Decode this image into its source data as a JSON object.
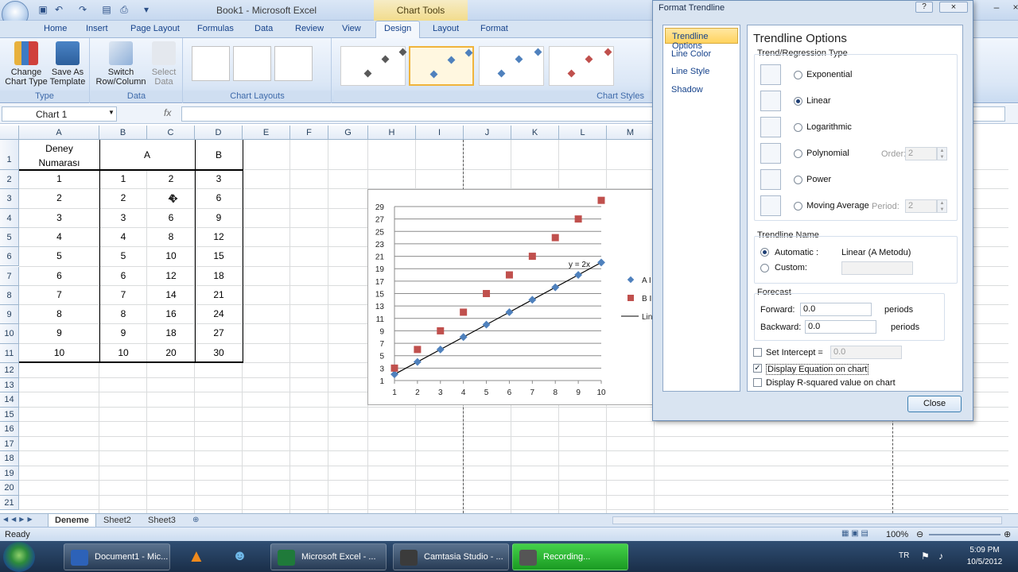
{
  "window": {
    "title": "Book1 - Microsoft Excel",
    "context_tab": "Chart Tools"
  },
  "tabs": [
    "Home",
    "Insert",
    "Page Layout",
    "Formulas",
    "Data",
    "Review",
    "View",
    "Design",
    "Layout",
    "Format"
  ],
  "ribbon": {
    "type_group": {
      "label": "Type",
      "change_chart_type": "Change Chart Type",
      "save_as_template": "Save As Template"
    },
    "data_group": {
      "label": "Data",
      "switch_row_column": "Switch Row/Column",
      "select_data": "Select Data"
    },
    "layouts_group": {
      "label": "Chart Layouts"
    },
    "styles_group": {
      "label": "Chart Styles"
    }
  },
  "formula_bar": {
    "name_box": "Chart 1",
    "fx": "fx",
    "formula": ""
  },
  "columns": [
    "A",
    "B",
    "C",
    "D",
    "E",
    "F",
    "G",
    "H",
    "I",
    "J",
    "K",
    "L",
    "M"
  ],
  "rows": [
    "1",
    "2",
    "3",
    "4",
    "5",
    "6",
    "7",
    "8",
    "9",
    "10",
    "11",
    "12",
    "13",
    "14",
    "15",
    "16",
    "17",
    "18",
    "19",
    "20",
    "21"
  ],
  "table": {
    "header_a": "Deney Numarası",
    "header_bc": "A",
    "header_d": "B",
    "data": [
      [
        "1",
        "1",
        "2",
        "3"
      ],
      [
        "2",
        "2",
        "4",
        "6"
      ],
      [
        "3",
        "3",
        "6",
        "9"
      ],
      [
        "4",
        "4",
        "8",
        "12"
      ],
      [
        "5",
        "5",
        "10",
        "15"
      ],
      [
        "6",
        "6",
        "12",
        "18"
      ],
      [
        "7",
        "7",
        "14",
        "21"
      ],
      [
        "8",
        "8",
        "16",
        "24"
      ],
      [
        "9",
        "9",
        "18",
        "27"
      ],
      [
        "10",
        "10",
        "20",
        "30"
      ]
    ]
  },
  "chart": {
    "equation_label": "y = 2x",
    "legend_a": "A I",
    "legend_b": "B I",
    "legend_line": "Lin",
    "y_ticks": [
      "1",
      "3",
      "5",
      "7",
      "9",
      "11",
      "13",
      "15",
      "17",
      "19",
      "21",
      "23",
      "25",
      "27",
      "29"
    ],
    "x_ticks": [
      "1",
      "2",
      "3",
      "4",
      "5",
      "6",
      "7",
      "8",
      "9",
      "10"
    ],
    "colors": {
      "series_a": "#4f81bd",
      "series_b": "#c0504d",
      "trendline": "#000000"
    }
  },
  "chart_data": {
    "type": "scatter",
    "x": [
      1,
      2,
      3,
      4,
      5,
      6,
      7,
      8,
      9,
      10
    ],
    "series": [
      {
        "name": "A I",
        "values": [
          2,
          4,
          6,
          8,
          10,
          12,
          14,
          16,
          18,
          20
        ]
      },
      {
        "name": "B I",
        "values": [
          3,
          6,
          9,
          12,
          15,
          18,
          21,
          24,
          27,
          30
        ]
      }
    ],
    "trendline": {
      "name": "Lin",
      "type": "linear",
      "of": "A I",
      "equation": "y = 2x"
    },
    "xlim": [
      1,
      10
    ],
    "ylim": [
      1,
      29
    ],
    "grid": true,
    "legend": "right"
  },
  "dialog": {
    "title": "Format Trendline",
    "nav": [
      "Trendline Options",
      "Line Color",
      "Line Style",
      "Shadow"
    ],
    "heading": "Trendline Options",
    "regression_section": "Trend/Regression Type",
    "types": [
      "Exponential",
      "Linear",
      "Logarithmic",
      "Polynomial",
      "Power",
      "Moving Average"
    ],
    "order_label": "Order:",
    "order_value": "2",
    "period_label": "Period:",
    "period_value": "2",
    "name_section": "Trendline Name",
    "automatic_label": "Automatic :",
    "automatic_value": "Linear (A Metodu)",
    "custom_label": "Custom:",
    "forecast_section": "Forecast",
    "forward_label": "Forward:",
    "forward_value": "0.0",
    "backward_label": "Backward:",
    "backward_value": "0.0",
    "periods_label": "periods",
    "intercept_label": "Set Intercept =",
    "intercept_value": "0.0",
    "display_equation": "Display Equation on chart",
    "display_r2": "Display R-squared value on chart",
    "close": "Close"
  },
  "sheets": [
    "Deneme",
    "Sheet2",
    "Sheet3"
  ],
  "status": {
    "ready": "Ready",
    "zoom": "100%"
  },
  "taskbar": {
    "items": [
      "Document1 - Mic...",
      "Microsoft Excel - ...",
      "Camtasia Studio - ...",
      "Recording..."
    ],
    "lang": "TR",
    "time": "5:09 PM",
    "date": "10/5/2012"
  }
}
